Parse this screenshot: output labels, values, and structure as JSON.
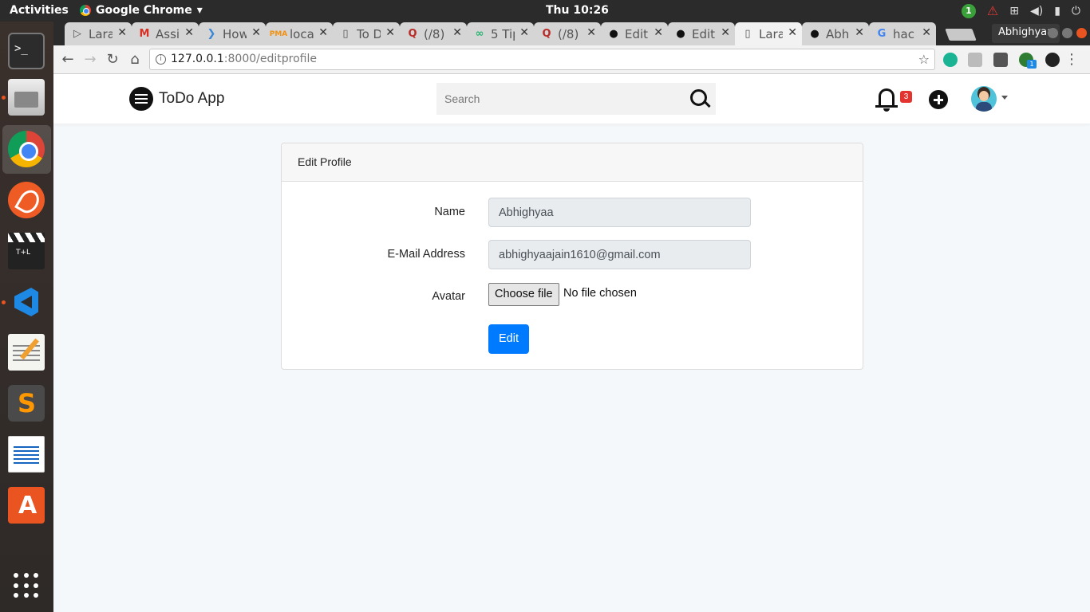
{
  "system": {
    "activities": "Activities",
    "app_name": "Google Chrome",
    "clock": "Thu 10:26",
    "update_count": "1"
  },
  "browser": {
    "tabs": [
      {
        "title": "Lara",
        "icon": "laravel-icon",
        "active": false
      },
      {
        "title": "Assi",
        "icon": "gmail-icon",
        "active": false
      },
      {
        "title": "How",
        "icon": "stackexchange-icon",
        "active": false
      },
      {
        "title": "loca",
        "icon": "phpmyadmin-icon",
        "active": false
      },
      {
        "title": "To D",
        "icon": "page-icon",
        "active": false
      },
      {
        "title": "(/8)",
        "icon": "quora-icon",
        "active": false
      },
      {
        "title": "5 Tip",
        "icon": "link-icon",
        "active": false
      },
      {
        "title": "(/8)",
        "icon": "quora-icon",
        "active": false
      },
      {
        "title": "Edit",
        "icon": "github-icon",
        "active": false
      },
      {
        "title": "Edit",
        "icon": "github-icon",
        "active": false
      },
      {
        "title": "Lara",
        "icon": "page-icon",
        "active": true
      },
      {
        "title": "Abh",
        "icon": "github-icon",
        "active": false
      },
      {
        "title": "hac",
        "icon": "google-icon",
        "active": false
      }
    ],
    "profile_name": "Abhighyaa",
    "url_host": "127.0.0.1",
    "url_path": ":8000/editprofile",
    "extension_badge": "1"
  },
  "app": {
    "brand": "ToDo App",
    "search_placeholder": "Search",
    "notification_count": "3"
  },
  "form": {
    "card_title": "Edit Profile",
    "name_label": "Name",
    "name_value": "Abhighyaa",
    "email_label": "E-Mail Address",
    "email_value": "abhighyaajain1610@gmail.com",
    "avatar_label": "Avatar",
    "file_button": "Choose file",
    "file_status": "No file chosen",
    "submit_label": "Edit"
  },
  "colors": {
    "primary": "#007bff",
    "badge": "#e3342f",
    "ubuntu_accent": "#e95420"
  }
}
